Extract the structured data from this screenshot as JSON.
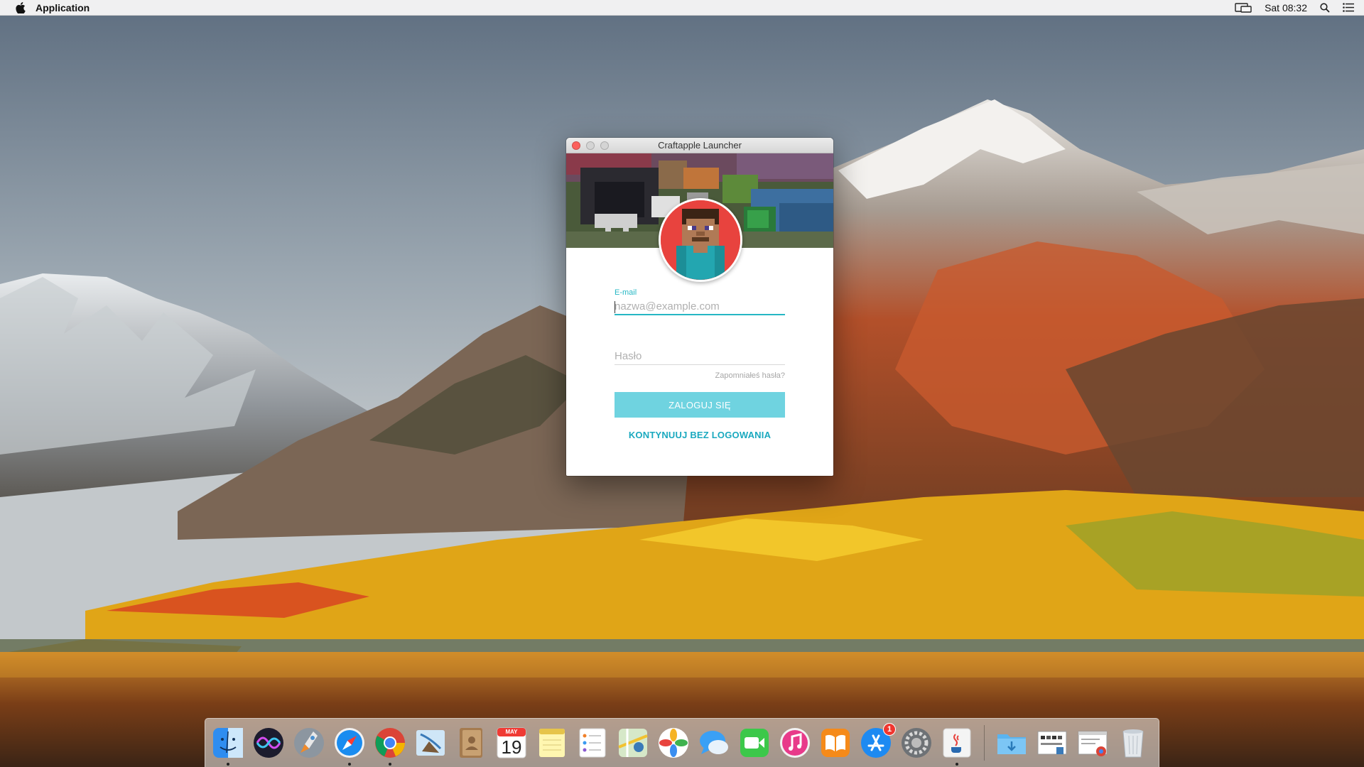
{
  "menubar": {
    "app_name": "Application",
    "clock": "Sat 08:32",
    "icons": [
      "apple-icon",
      "display-mirroring-icon",
      "spotlight-search-icon",
      "notification-center-icon"
    ]
  },
  "window": {
    "title": "Craftapple Launcher",
    "email_label": "E-mail",
    "email_placeholder": "nazwa@example.com",
    "email_value": "",
    "password_placeholder": "Hasło",
    "password_value": "",
    "forgot_password": "Zapomniałeś hasła?",
    "login_button": "ZALOGUJ SIĘ",
    "continue_without_login": "KONTYNUUJ BEZ LOGOWANIA",
    "accent_color": "#26b7c4",
    "button_color": "#6fd3e0"
  },
  "dock": {
    "apps": [
      {
        "name": "Finder",
        "icon": "finder-icon",
        "running": true
      },
      {
        "name": "Siri",
        "icon": "siri-icon",
        "running": false
      },
      {
        "name": "Launchpad",
        "icon": "launchpad-icon",
        "running": false
      },
      {
        "name": "Safari",
        "icon": "safari-icon",
        "running": true
      },
      {
        "name": "Google Chrome",
        "icon": "chrome-icon",
        "running": true
      },
      {
        "name": "Mail",
        "icon": "mail-icon",
        "running": false
      },
      {
        "name": "Contacts",
        "icon": "contacts-icon",
        "running": false
      },
      {
        "name": "Calendar",
        "icon": "calendar-icon",
        "running": false
      },
      {
        "name": "Notes",
        "icon": "notes-icon",
        "running": false
      },
      {
        "name": "Reminders",
        "icon": "reminders-icon",
        "running": false
      },
      {
        "name": "Maps",
        "icon": "maps-icon",
        "running": false
      },
      {
        "name": "Photos",
        "icon": "photos-icon",
        "running": false
      },
      {
        "name": "Messages",
        "icon": "messages-icon",
        "running": false
      },
      {
        "name": "FaceTime",
        "icon": "facetime-icon",
        "running": false
      },
      {
        "name": "iTunes",
        "icon": "itunes-icon",
        "running": false
      },
      {
        "name": "iBooks",
        "icon": "ibooks-icon",
        "running": false
      },
      {
        "name": "App Store",
        "icon": "app-store-icon",
        "running": false,
        "badge": "1"
      },
      {
        "name": "System Preferences",
        "icon": "system-preferences-icon",
        "running": false
      },
      {
        "name": "Java",
        "icon": "java-icon",
        "running": true
      }
    ],
    "calendar_month": "MAY",
    "calendar_day": "19",
    "app_store_badge": "1",
    "stacks": [
      {
        "name": "Downloads",
        "icon": "downloads-folder-icon"
      },
      {
        "name": "Screenshot",
        "icon": "screenshot-stack-icon"
      },
      {
        "name": "Chrome document",
        "icon": "chrome-document-icon"
      },
      {
        "name": "Trash",
        "icon": "trash-icon"
      }
    ]
  }
}
